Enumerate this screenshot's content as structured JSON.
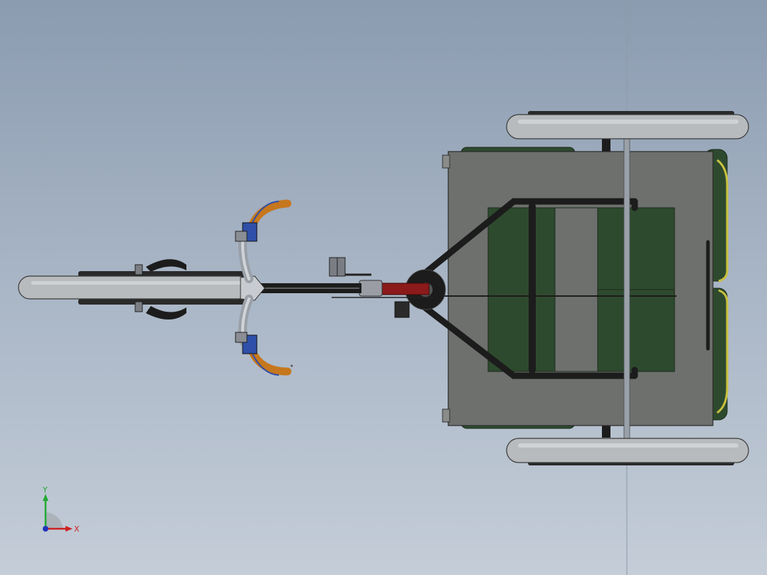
{
  "view": {
    "background_top": "#8b9bb0",
    "background_bottom": "#c4cdd8"
  },
  "model": {
    "tire_color": "#b8bbbd",
    "frame_color": "#1c1c1c",
    "seat_color": "#2e4a2e",
    "body_panel_color": "#6e706e",
    "grip_color": "#c6771e",
    "brake_lever_color": "#2f4fa8",
    "drive_accent_color": "#8b1a1a"
  },
  "triad": {
    "x_label": "X",
    "y_label": "Y",
    "x_color": "#cc2222",
    "y_color": "#22aa33",
    "z_color": "#2233bb"
  }
}
